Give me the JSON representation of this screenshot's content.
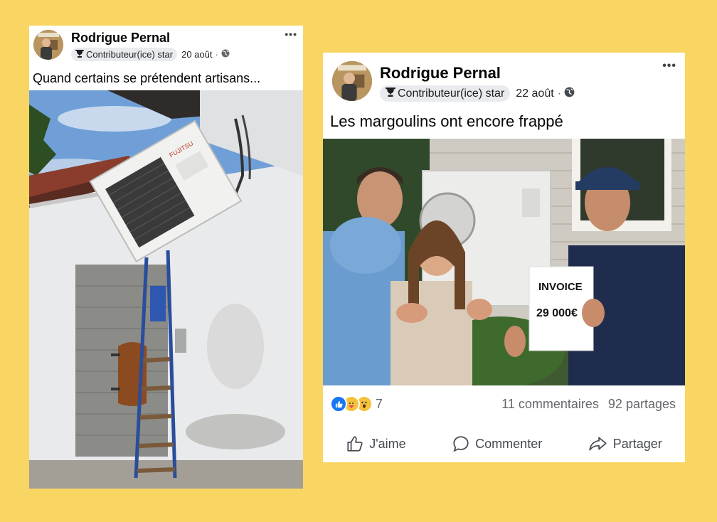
{
  "posts": [
    {
      "author": "Rodrigue Pernal",
      "badge": "Contributeur(ice) star",
      "date": "20 août",
      "separator": "·",
      "more": "•••",
      "caption": "Quand certains se prétendent artisans...",
      "unit_brand": "FUJITSU"
    },
    {
      "author": "Rodrigue Pernal",
      "badge": "Contributeur(ice) star",
      "date": "22 août",
      "separator": "·",
      "more": "•••",
      "caption": "Les margoulins ont encore frappé",
      "sign_title": "INVOICE",
      "sign_amount": "29 000€",
      "reaction_count": "7",
      "comments": "11 commentaires",
      "shares": "92 partages",
      "actions": {
        "like": "J'aime",
        "comment": "Commenter",
        "share": "Partager"
      }
    }
  ],
  "colors": {
    "background": "#f9d663",
    "like_blue": "#1877f2",
    "text_secondary": "#65676b"
  },
  "icons": [
    "trophy-icon",
    "globe-icon",
    "like-icon",
    "comment-icon",
    "share-icon"
  ]
}
